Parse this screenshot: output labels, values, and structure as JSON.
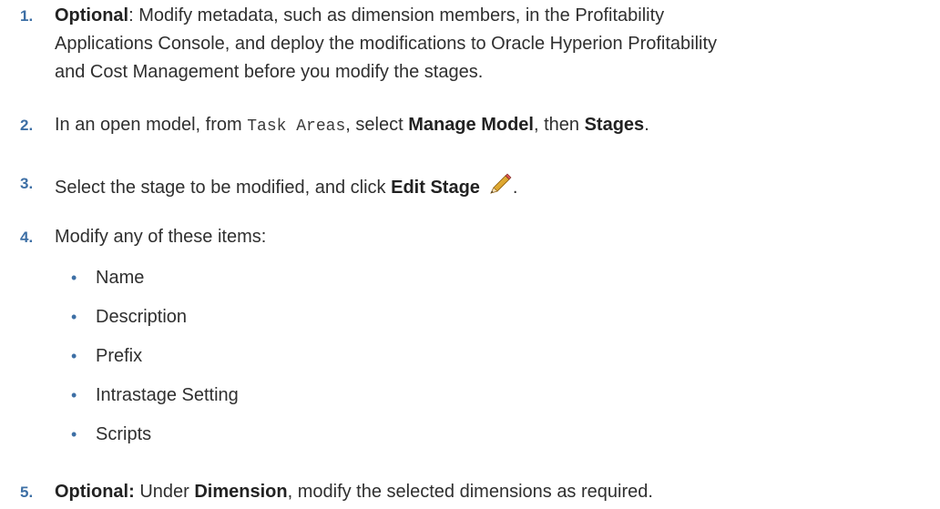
{
  "steps": [
    {
      "number": "1.",
      "lines": [
        {
          "bold": "Optional",
          "text": ": Modify metadata, such as dimension members, in the Profitability"
        },
        {
          "text": "Applications Console, and deploy the modifications to Oracle Hyperion Profitability"
        },
        {
          "text": "and Cost Management before you modify the stages."
        }
      ]
    },
    {
      "number": "2.",
      "pre": "In an open model, from ",
      "code": "Task Areas",
      "mid": ", select ",
      "bold1": "Manage Model",
      "mid2": ", then ",
      "bold2": "Stages",
      "post": "."
    },
    {
      "number": "3.",
      "pre": "Select the stage to be modified, and click ",
      "bold": "Edit Stage",
      "post": "."
    },
    {
      "number": "4.",
      "text": "Modify any of these items:",
      "items": [
        "Name",
        "Description",
        "Prefix",
        "Intrastage Setting",
        "Scripts"
      ]
    },
    {
      "number": "5.",
      "bold1": "Optional:",
      "mid": " Under ",
      "bold2": "Dimension",
      "post": ", modify the selected dimensions as required."
    }
  ],
  "bullet_char": "•",
  "icons": {
    "edit_stage": "pencil-icon"
  },
  "colors": {
    "number": "#3d6fa5",
    "bullet": "#3d6fa5",
    "text": "#2f2f2f"
  }
}
